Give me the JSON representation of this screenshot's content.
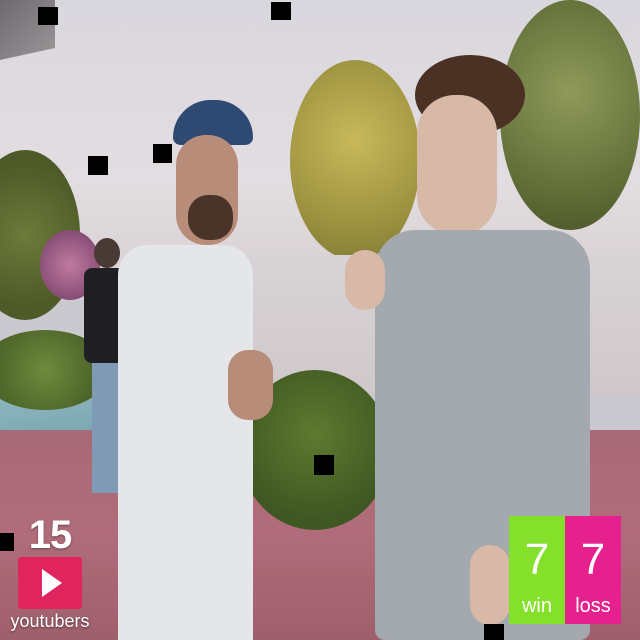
{
  "overlay": {
    "youtubers": {
      "count": "15",
      "label": "youtubers",
      "icon": "play-icon",
      "color": "#e0245e"
    },
    "win": {
      "value": "7",
      "label": "win",
      "color": "#84e02a"
    },
    "loss": {
      "value": "7",
      "label": "loss",
      "color": "#e6208c"
    }
  }
}
